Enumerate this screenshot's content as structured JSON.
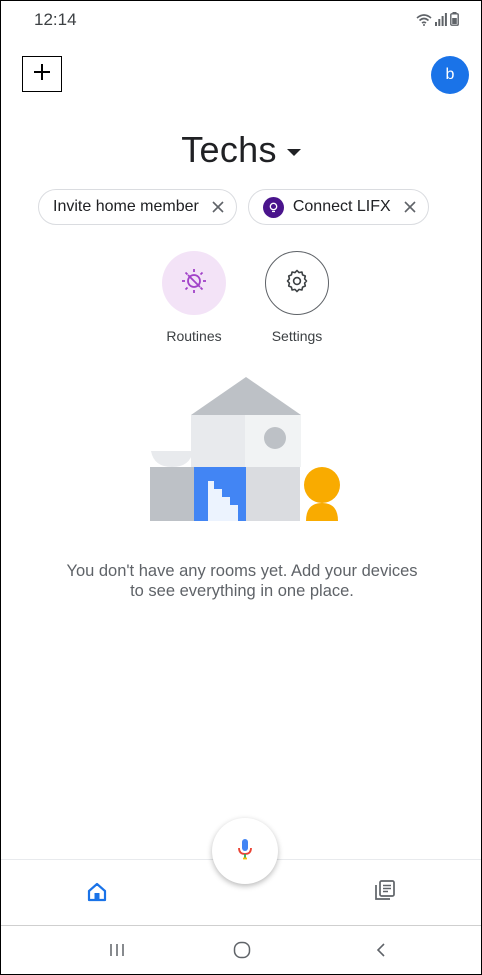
{
  "status_bar": {
    "time": "12:14",
    "icons": [
      "wifi-icon",
      "signal-icon",
      "battery-icon"
    ]
  },
  "top_bar": {
    "add_icon": "plus-icon",
    "avatar_initial": "b",
    "avatar_color": "#1a73e8"
  },
  "home": {
    "title": "Techs",
    "caret_icon": "caret-down-icon"
  },
  "chips": [
    {
      "label": "Invite home member",
      "icon": null,
      "close_icon": "close-icon"
    },
    {
      "label": "Connect LIFX",
      "icon": "lifx-icon",
      "close_icon": "close-icon"
    }
  ],
  "actions": [
    {
      "label": "Routines",
      "icon": "routines-icon",
      "bg_color": "#f3e3f7"
    },
    {
      "label": "Settings",
      "icon": "gear-icon"
    }
  ],
  "empty_state": {
    "illustration": "house-illustration",
    "message": "You don't have any rooms yet. Add your devices to see everything in one place."
  },
  "fab": {
    "icon": "mic-icon"
  },
  "bottom_nav": [
    {
      "name": "home",
      "icon": "home-icon",
      "active": true,
      "color": "#1a73e8"
    },
    {
      "name": "feed",
      "icon": "feed-icon",
      "active": false,
      "color": "#5f6368"
    }
  ],
  "system_nav": [
    "recents-icon",
    "home-circle-icon",
    "back-icon"
  ]
}
